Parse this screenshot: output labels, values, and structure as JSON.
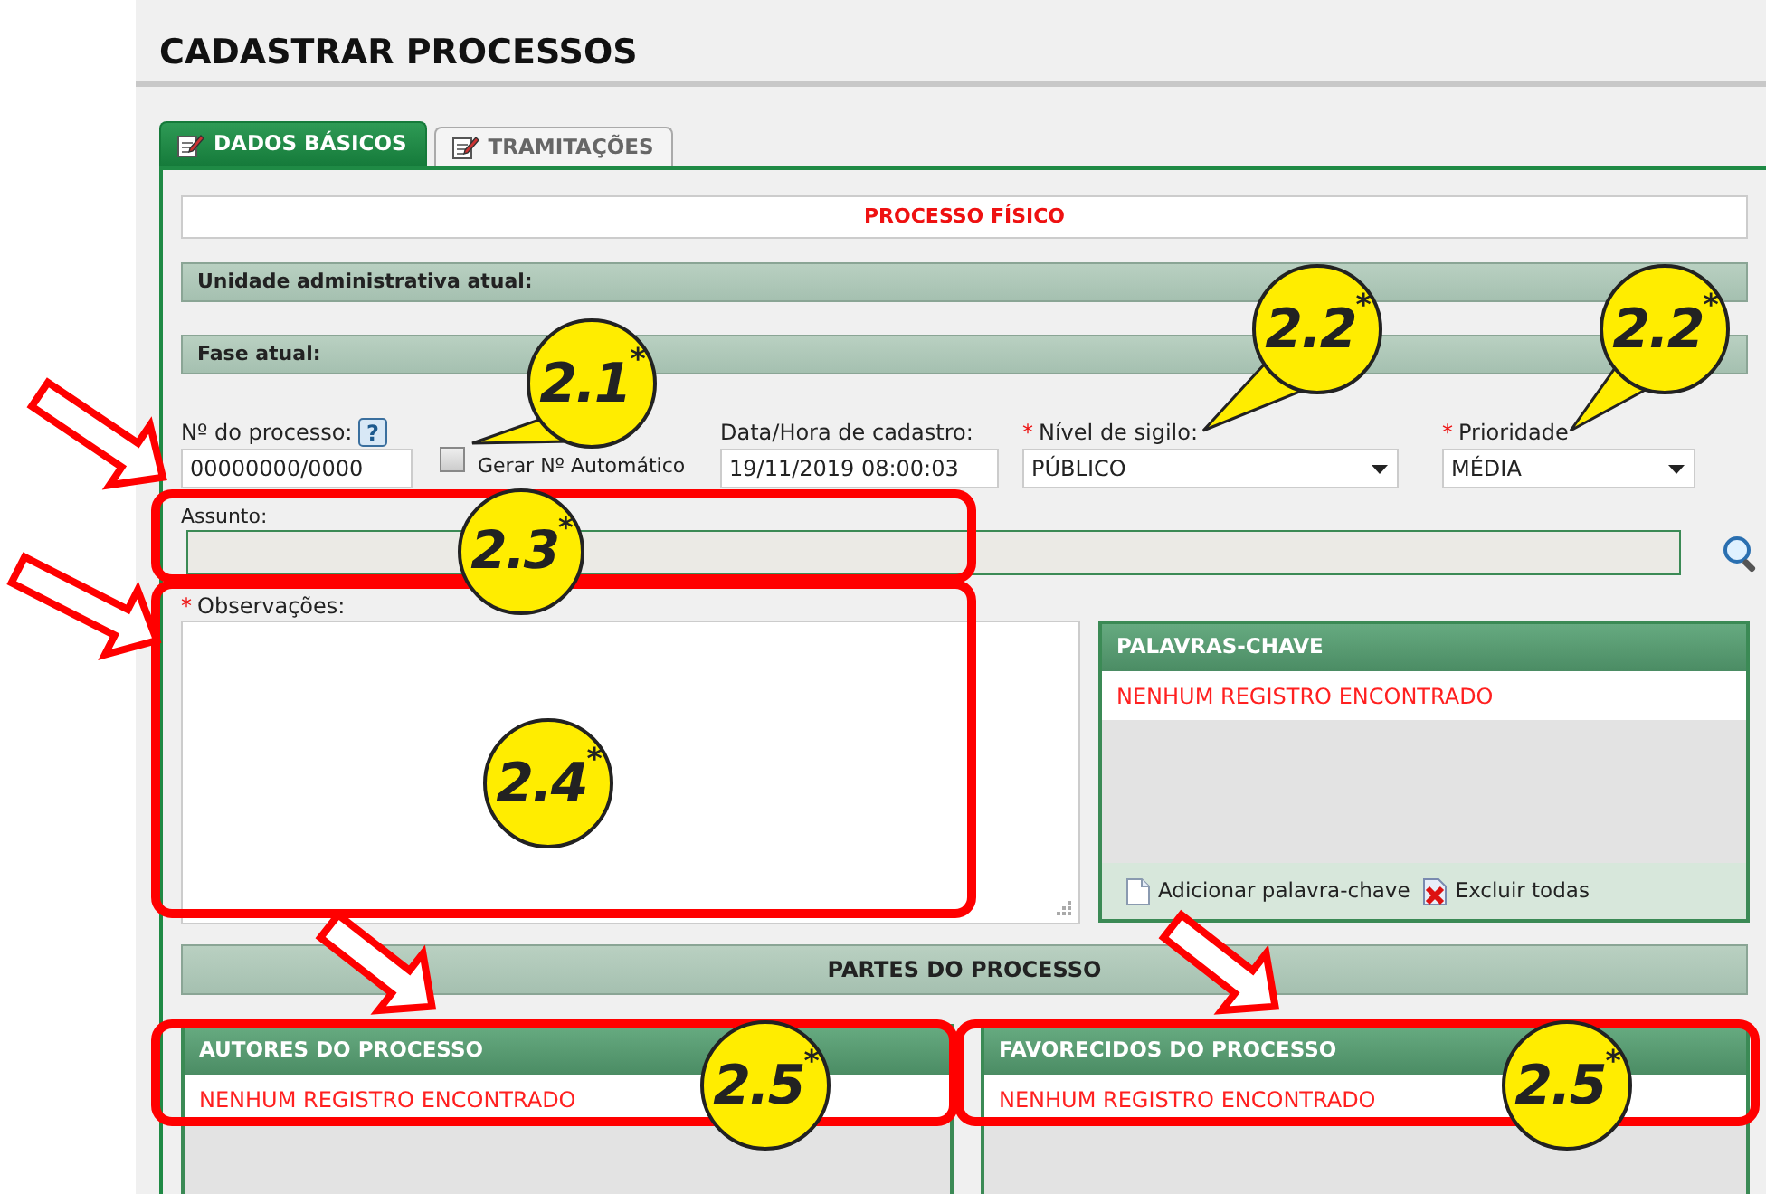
{
  "page_title": "CADASTRAR PROCESSOS",
  "tabs": [
    {
      "label": "DADOS BÁSICOS",
      "selected": true
    },
    {
      "label": "TRAMITAÇÕES",
      "selected": false
    }
  ],
  "process_type": "PROCESSO FÍSICO",
  "section_bars": [
    "Unidade administrativa atual:",
    "Fase atual:"
  ],
  "fields": {
    "process_number": {
      "label": "Nº do processo:",
      "help": "?",
      "value": "00000000/0000"
    },
    "auto_number": {
      "label": "Gerar Nº Automático",
      "checked": false
    },
    "created": {
      "label": "Data/Hora de cadastro:",
      "value": "19/11/2019 08:00:03"
    },
    "secrecy": {
      "required_mark": "*",
      "label": "Nível de sigilo:",
      "value": "PÚBLICO"
    },
    "priority": {
      "required_mark": "*",
      "label": "Prioridade",
      "value": "MÉDIA"
    },
    "subject": {
      "label": "Assunto:",
      "disabled": true
    },
    "notes": {
      "required_mark": "*",
      "label": "Observações:"
    }
  },
  "keywords": {
    "title": "PALAVRAS-CHAVE",
    "empty": "NENHUM REGISTRO ENCONTRADO",
    "actions": [
      "Adicionar palavra-chave",
      "Excluir todas"
    ]
  },
  "parts": {
    "title": "PARTES DO PROCESSO",
    "panels": [
      {
        "title": "AUTORES DO PROCESSO",
        "empty": "NENHUM REGISTRO ENCONTRADO"
      },
      {
        "title": "FAVORECIDOS DO PROCESSO",
        "empty": "NENHUM REGISTRO ENCONTRADO"
      }
    ]
  },
  "annotations": [
    {
      "label": "2.1$^{*}$"
    },
    {
      "label": "2.2$^{*}$"
    },
    {
      "label": "2.2$^{*}$"
    },
    {
      "label": "2.3$^{*}$"
    },
    {
      "label": "2.4$^{*}$"
    },
    {
      "label": "2.5$^{*}$"
    },
    {
      "label": "2.5$^{*}$"
    }
  ]
}
